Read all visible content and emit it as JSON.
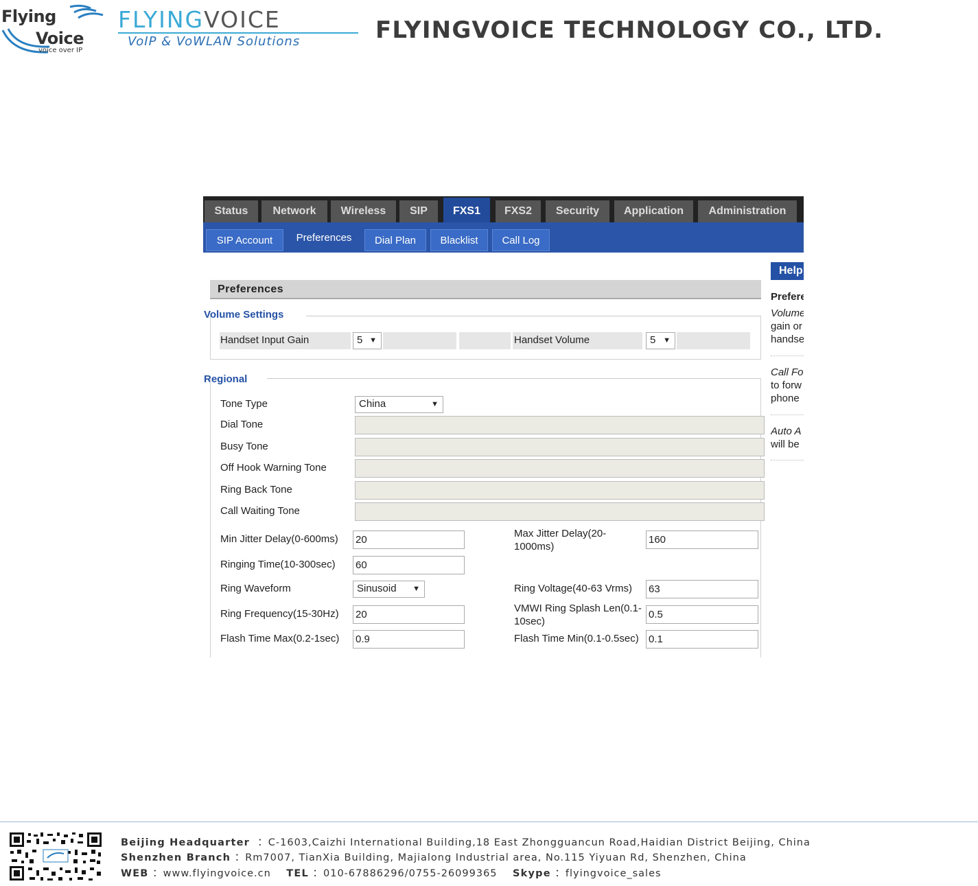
{
  "header": {
    "logo1_line1": "Flying",
    "logo1_line2": "Voice",
    "logo1_tagline": "voice over IP",
    "logo2_part1": "FLYING",
    "logo2_part2": "VOICE",
    "logo2_tagline": "VoIP & VoWLAN Solutions",
    "company": "FLYINGVOICE TECHNOLOGY CO., LTD."
  },
  "nav": {
    "tabs": [
      "Status",
      "Network",
      "Wireless",
      "SIP",
      "FXS1",
      "FXS2",
      "Security",
      "Application",
      "Administration"
    ],
    "active_tab": "FXS1",
    "subtabs": [
      "SIP Account",
      "Preferences",
      "Dial Plan",
      "Blacklist",
      "Call Log"
    ],
    "active_subtab": "Preferences"
  },
  "page": {
    "title": "Preferences",
    "volume": {
      "title": "Volume Settings",
      "input_gain_label": "Handset Input Gain",
      "input_gain_value": "5",
      "handset_volume_label": "Handset Volume",
      "handset_volume_value": "5"
    },
    "regional": {
      "title": "Regional",
      "tone_type_label": "Tone Type",
      "tone_type_value": "China",
      "dial_tone_label": "Dial Tone",
      "busy_tone_label": "Busy Tone",
      "offhook_label": "Off Hook Warning Tone",
      "ringback_label": "Ring Back Tone",
      "callwaiting_label": "Call Waiting Tone",
      "min_jitter_label": "Min Jitter Delay(0-600ms)",
      "min_jitter_value": "20",
      "max_jitter_label_1": "Max Jitter Delay(20-",
      "max_jitter_label_2": "1000ms)",
      "max_jitter_value": "160",
      "ringing_time_label": "Ringing Time(10-300sec)",
      "ringing_time_value": "60",
      "ring_waveform_label": "Ring Waveform",
      "ring_waveform_value": "Sinusoid",
      "ring_voltage_label": "Ring Voltage(40-63 Vrms)",
      "ring_voltage_value": "63",
      "ring_freq_label": "Ring Frequency(15-30Hz)",
      "ring_freq_value": "20",
      "vmwi_label_1": "VMWI Ring Splash Len(0.1-",
      "vmwi_label_2": "10sec)",
      "vmwi_value": "0.5",
      "flash_max_label": "Flash Time Max(0.2-1sec)",
      "flash_max_value": "0.9",
      "flash_min_label": "Flash Time Min(0.1-0.5sec)",
      "flash_min_value": "0.1"
    }
  },
  "help": {
    "tab": "Help",
    "title": "Preferences",
    "p1_italic": "Volume",
    "p1_line2": "gain or",
    "p1_line3": "handset",
    "p2_italic": "Call Fo",
    "p2_line2": "to forw",
    "p2_line3": "phone",
    "p3_italic": "Auto A",
    "p3_line2": "will be"
  },
  "footer": {
    "hq_label": "Beijing Headquarter",
    "hq_text": "：C-1603,Caizhi International Building,18 East Zhongguancun Road,Haidian District Beijing, China",
    "sz_label": "Shenzhen Branch",
    "sz_text": "：Rm7007, TianXia Building, Majialong Industrial area, No.115 Yiyuan Rd, Shenzhen, China",
    "web_label": "WEB",
    "web_text": "：www.flyingvoice.cn",
    "tel_label": "TEL",
    "tel_text": "：010-67886296/0755-26099365",
    "skype_label": "Skype",
    "skype_text": "：flyingvoice_sales"
  },
  "colors": {
    "nav_active": "#234b9b",
    "subnav": "#2b55a8",
    "group_title": "#2451a5",
    "logo_cyan": "#3aa9d6",
    "logo_grey": "#555555"
  }
}
